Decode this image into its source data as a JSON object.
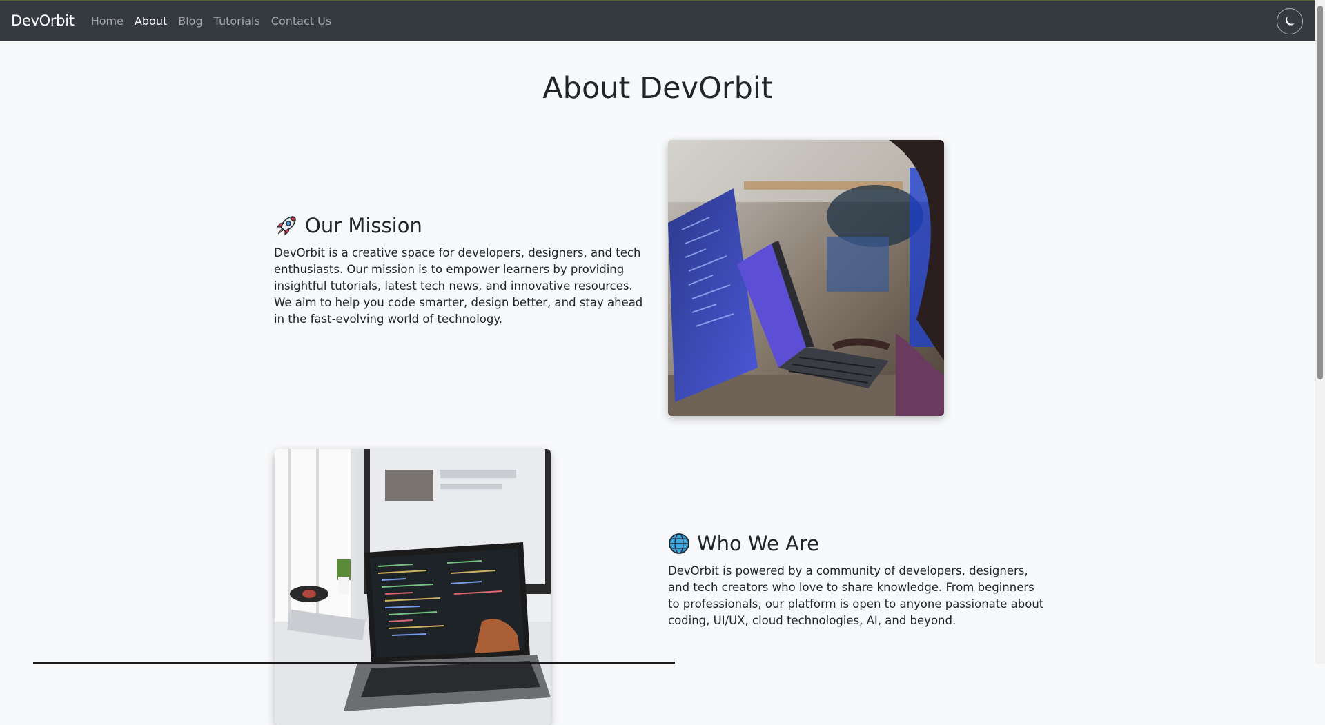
{
  "navbar": {
    "brand": "DevOrbit",
    "links": [
      {
        "label": "Home",
        "active": false
      },
      {
        "label": "About",
        "active": true
      },
      {
        "label": "Blog",
        "active": false
      },
      {
        "label": "Tutorials",
        "active": false
      },
      {
        "label": "Contact Us",
        "active": false
      }
    ],
    "theme_toggle_icon": "moon-icon"
  },
  "page": {
    "title": "About DevOrbit"
  },
  "sections": [
    {
      "icon": "rocket-icon",
      "heading": "Our Mission",
      "text": "DevOrbit is a creative space for developers, designers, and tech enthusiasts. Our mission is to empower learners by providing insightful tutorials, latest tech news, and innovative resources. We aim to help you code smarter, design better, and stay ahead in the fast-evolving world of technology.",
      "image": "people-coding-on-laptops-photo"
    },
    {
      "icon": "globe-icon",
      "heading": "Who We Are",
      "text": "DevOrbit is powered by a community of developers, designers, and tech creators who love to share knowledge. From beginners to professionals, our platform is open to anyone passionate about coding, UI/UX, cloud technologies, AI, and beyond.",
      "image": "laptop-with-code-on-desk-photo"
    }
  ],
  "colors": {
    "navbar_bg": "#343a40",
    "page_bg": "#f8f9fa",
    "text": "#212529"
  }
}
